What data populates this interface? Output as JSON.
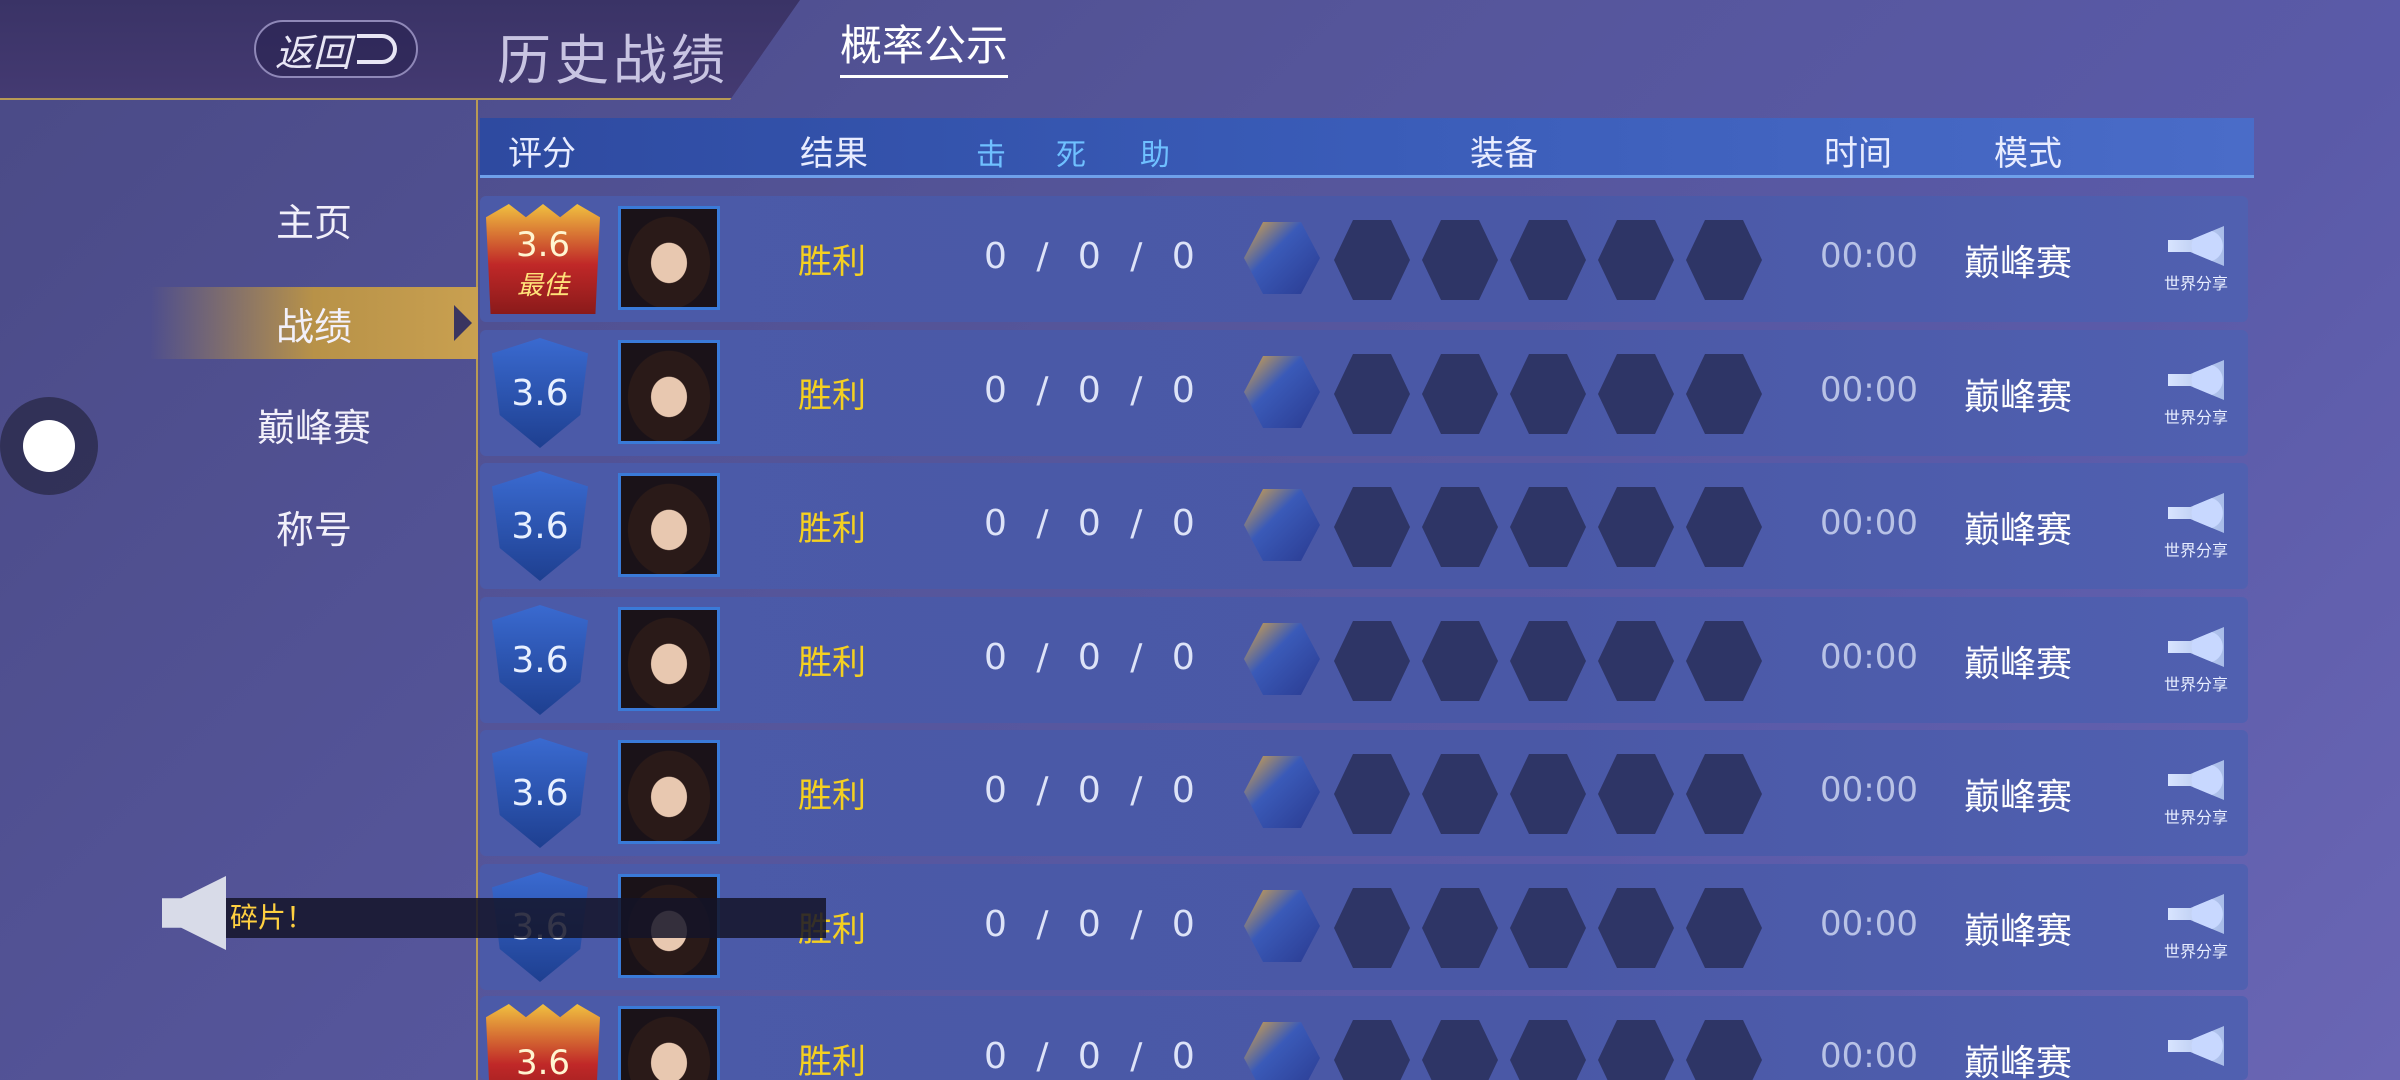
{
  "header": {
    "back_label": "返回",
    "title": "历史战绩",
    "probability_link": "概率公示"
  },
  "sidebar": {
    "items": [
      {
        "label": "主页",
        "active": false
      },
      {
        "label": "战绩",
        "active": true
      },
      {
        "label": "巅峰赛",
        "active": false
      },
      {
        "label": "称号",
        "active": false
      }
    ]
  },
  "table": {
    "columns": {
      "score": "评分",
      "result": "结果",
      "kills": "击",
      "deaths": "死",
      "assists": "助",
      "equipment": "装备",
      "time": "时间",
      "mode": "模式"
    },
    "rows": [
      {
        "score": "3.6",
        "best": true,
        "best_label": "最佳",
        "result": "胜利",
        "kda": "0 / 0 / 0",
        "time": "00:00",
        "mode": "巅峰赛",
        "share": "世界分享"
      },
      {
        "score": "3.6",
        "best": false,
        "result": "胜利",
        "kda": "0 / 0 / 0",
        "time": "00:00",
        "mode": "巅峰赛",
        "share": "世界分享"
      },
      {
        "score": "3.6",
        "best": false,
        "result": "胜利",
        "kda": "0 / 0 / 0",
        "time": "00:00",
        "mode": "巅峰赛",
        "share": "世界分享"
      },
      {
        "score": "3.6",
        "best": false,
        "result": "胜利",
        "kda": "0 / 0 / 0",
        "time": "00:00",
        "mode": "巅峰赛",
        "share": "世界分享"
      },
      {
        "score": "3.6",
        "best": false,
        "result": "胜利",
        "kda": "0 / 0 / 0",
        "time": "00:00",
        "mode": "巅峰赛",
        "share": "世界分享"
      },
      {
        "score": "3.6",
        "best": false,
        "result": "胜利",
        "kda": "0 / 0 / 0",
        "time": "00:00",
        "mode": "巅峰赛",
        "share": "世界分享"
      },
      {
        "score": "3.6",
        "best": true,
        "best_label": "",
        "result": "胜利",
        "kda": "0 / 0 / 0",
        "time": "00:00",
        "mode": "巅峰赛",
        "share": ""
      }
    ]
  },
  "notice": {
    "text": "碎片！"
  },
  "colors": {
    "result_win": "#f5d020",
    "accent_gold": "#b89a55",
    "header_blue": "#3a5cb8"
  }
}
